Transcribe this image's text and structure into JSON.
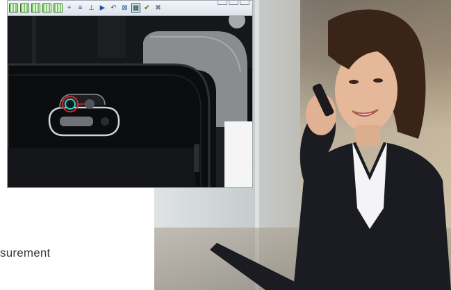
{
  "caption": {
    "text": "surement"
  },
  "app": {
    "title": "",
    "toolbar": [
      {
        "name": "grid-tool-1-icon",
        "glyph": "",
        "style": "grid"
      },
      {
        "name": "grid-tool-2-icon",
        "glyph": "",
        "style": "grid"
      },
      {
        "name": "grid-tool-3-icon",
        "glyph": "",
        "style": "grid"
      },
      {
        "name": "grid-tool-4-icon",
        "glyph": "",
        "style": "grid"
      },
      {
        "name": "grid-tool-5-icon",
        "glyph": "",
        "style": "grid"
      },
      {
        "name": "crosshair-icon",
        "glyph": "+",
        "style": "blue"
      },
      {
        "name": "layers-icon",
        "glyph": "≡",
        "style": "blue"
      },
      {
        "name": "measure-icon",
        "glyph": "⊥",
        "style": "blue"
      },
      {
        "name": "pointer-icon",
        "glyph": "▶",
        "style": "blue"
      },
      {
        "name": "rotate-icon",
        "glyph": "↶",
        "style": "blue"
      },
      {
        "name": "fit-icon",
        "glyph": "⊠",
        "style": "blue"
      },
      {
        "name": "region-select-icon",
        "glyph": "▦",
        "style": "sel"
      },
      {
        "name": "accept-icon",
        "glyph": "✔",
        "style": "chk"
      },
      {
        "name": "reject-icon",
        "glyph": "✖",
        "style": "x"
      }
    ]
  }
}
